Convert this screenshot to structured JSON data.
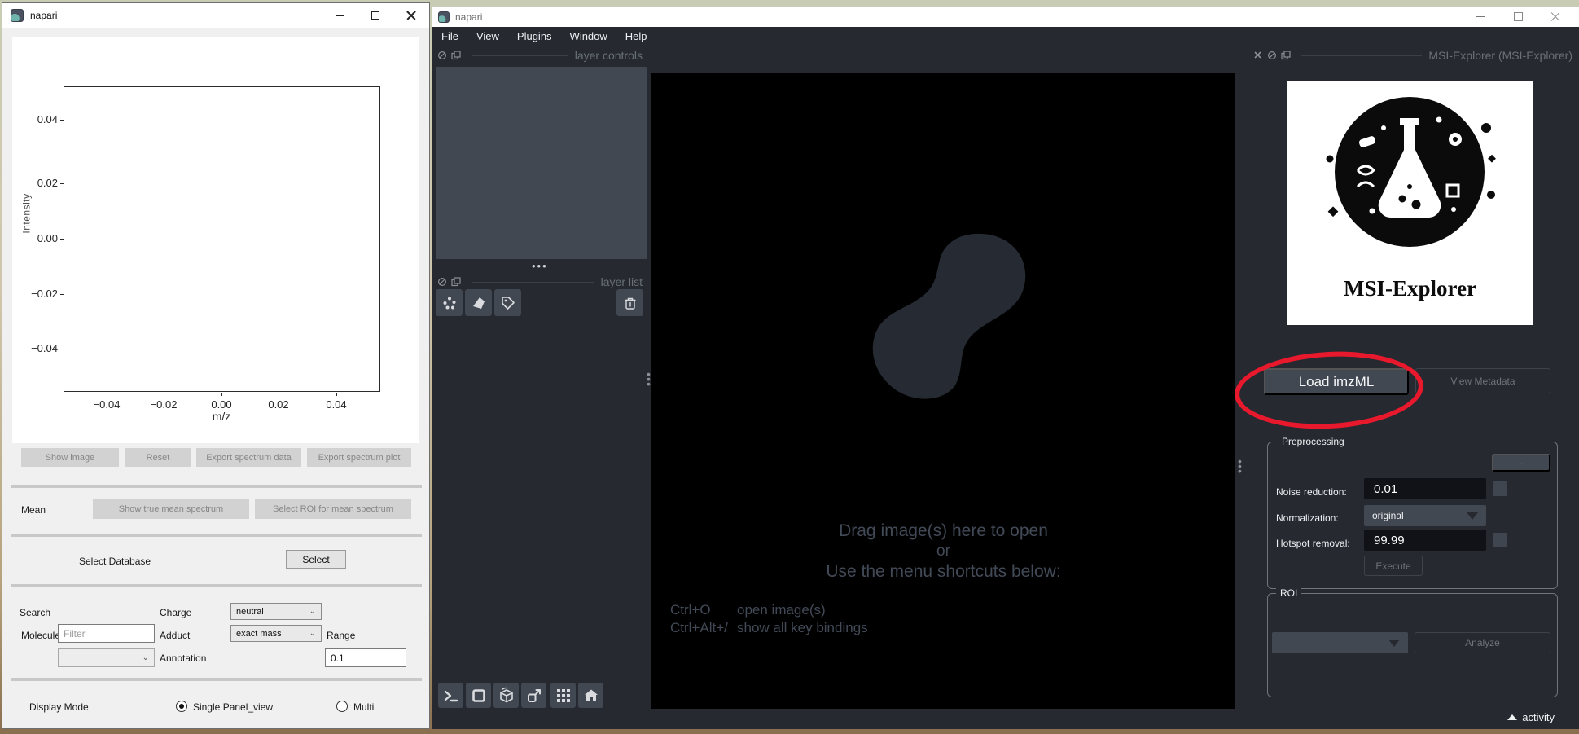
{
  "colors": {
    "napari_bg": "#262930",
    "napari_panel": "#414851",
    "canvas_black": "#000000",
    "hint_text": "#424a57",
    "annotation_red": "#e8192c",
    "light_bg": "#f0f0f0"
  },
  "left_window": {
    "title": "napari",
    "plot": {
      "ylabel": "Intensity",
      "xlabel": "m/z",
      "yticks": [
        "0.04",
        "0.02",
        "0.00",
        "−0.02",
        "−0.04"
      ],
      "xticks": [
        "−0.04",
        "−0.02",
        "0.00",
        "0.02",
        "0.04"
      ]
    },
    "spectrum_buttons": [
      "Show image",
      "Reset",
      "Export spectrum data",
      "Export spectrum plot"
    ],
    "mean": {
      "label": "Mean",
      "true_mean_button": "Show true mean spectrum",
      "roi_mean_button": "Select ROI for mean spectrum"
    },
    "database": {
      "label": "Select Database",
      "select_button": "Select"
    },
    "search": {
      "section_label": "Search",
      "charge_label": "Charge",
      "charge_value": "neutral",
      "molecule_label": "Molecule",
      "molecule_placeholder": "Filter",
      "adduct_label": "Adduct",
      "adduct_value": "exact mass",
      "range_label": "Range",
      "range_value": "0.1",
      "annotation_label": "Annotation"
    },
    "display_mode": {
      "label": "Display Mode",
      "option_single": "Single Panel_view",
      "option_multi": "Multi"
    }
  },
  "right_window": {
    "title": "napari",
    "menu": [
      "File",
      "View",
      "Plugins",
      "Window",
      "Help"
    ],
    "layer_controls_title": "layer controls",
    "layer_list_title": "layer list",
    "canvas": {
      "drop_line1": "Drag image(s) here to open",
      "drop_line2": "or",
      "drop_line3": "Use the menu shortcuts below:",
      "shortcut1_keys": "Ctrl+O",
      "shortcut1_action": "open image(s)",
      "shortcut2_keys": "Ctrl+Alt+/",
      "shortcut2_action": "show all key bindings"
    },
    "msi_panel": {
      "title": "MSI-Explorer (MSI-Explorer)",
      "logo_caption": "MSI-Explorer",
      "load_button": "Load imzML",
      "metadata_button": "View Metadata",
      "preprocessing": {
        "title": "Preprocessing",
        "collapse_button": "-",
        "noise_label": "Noise reduction:",
        "noise_value": "0.01",
        "normalization_label": "Normalization:",
        "normalization_value": "original",
        "hotspot_label": "Hotspot removal:",
        "hotspot_value": "99.99",
        "execute_button": "Execute"
      },
      "roi": {
        "title": "ROI",
        "analyze_button": "Analyze"
      }
    },
    "activity_label": "activity"
  }
}
